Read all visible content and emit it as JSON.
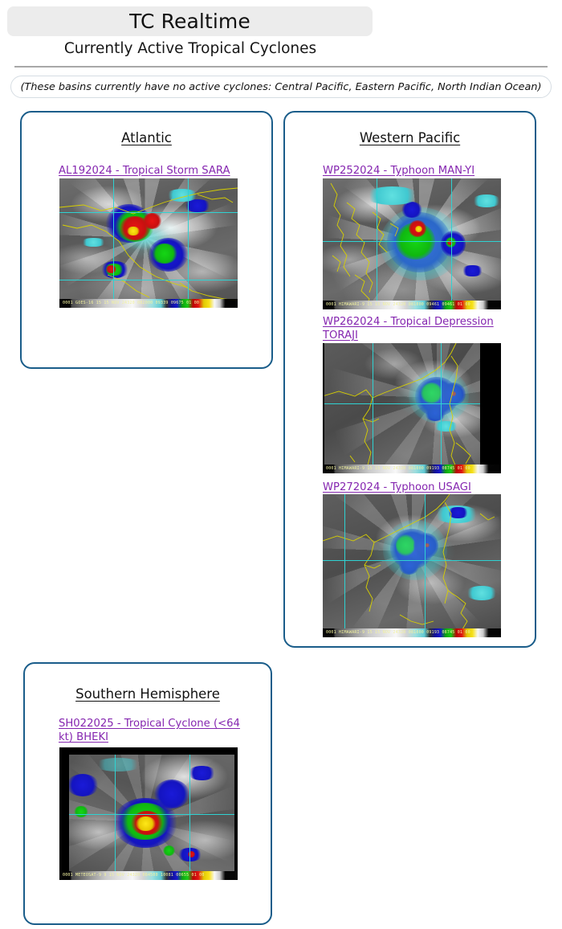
{
  "header": {
    "title": "TC Realtime",
    "subtitle": "Currently Active Tropical Cyclones",
    "notice": "(These basins currently have no active cyclones: Central Pacific, Eastern Pacific, North Indian Ocean)"
  },
  "basins": [
    {
      "id": "atlantic",
      "title": "Atlantic",
      "storms": [
        {
          "link": "AL192024 - Tropical Storm SARA",
          "satellite_caption": "0001 GOES-16   15 15 NOV 24320 082000 09339 09675 01 00"
        }
      ]
    },
    {
      "id": "western-pacific",
      "title": "Western Pacific",
      "storms": [
        {
          "link": "WP252024 - Typhoon MAN-YI",
          "satellite_caption": "0001 HIMAWARI-9 15 15 NOV 24320 081000 09461 09461 01 00"
        },
        {
          "link": "WP262024 - Tropical Depression TORAJI",
          "satellite_caption": "0001 HIMAWARI-9 15 15 NOV 24320 081000 09193 08745 01 00"
        },
        {
          "link": "WP272024 - Typhoon USAGI",
          "satellite_caption": "0001 HIMAWARI-9 15 15 NOV 24320 081000 09193 08745 01 00"
        }
      ]
    },
    {
      "id": "southern-hemisphere",
      "title": "Southern Hemisphere",
      "storms": [
        {
          "link": "SH022025 - Tropical Cyclone (<64 kt) BHEKI",
          "satellite_caption": "0001 METEOSAT-9   9 15 NOV 24320 084500 10081 00655 01 00"
        }
      ]
    }
  ],
  "colors": {
    "card_border": "#1a5d8a",
    "link": "#8526b0",
    "title_pill_bg": "#ececec",
    "rule": "#a8a8a8"
  }
}
